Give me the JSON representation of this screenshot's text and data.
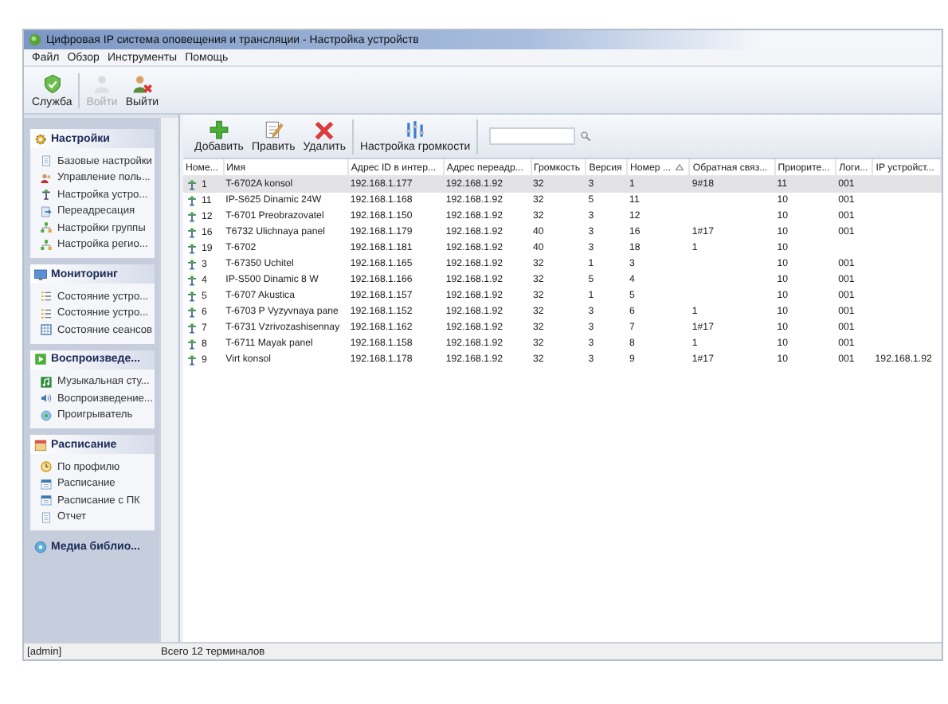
{
  "window": {
    "title": "Цифровая IP система оповещения и трансляции  -  Настройка устройств"
  },
  "menu": [
    "Файл",
    "Обзор",
    "Инструменты",
    "Помощь"
  ],
  "toolbar": [
    {
      "label": "Служба",
      "kind": "service",
      "disabled": false
    },
    {
      "label": "Войти",
      "kind": "login",
      "disabled": true
    },
    {
      "label": "Выйти",
      "kind": "logout",
      "disabled": false
    }
  ],
  "sidebar": {
    "groups": [
      {
        "title": "Настройки",
        "kind": "settings",
        "expanded": true,
        "items": [
          {
            "label": "Базовые настройки",
            "kind": "doc"
          },
          {
            "label": "Управление поль...",
            "kind": "users"
          },
          {
            "label": "Настройка устро...",
            "kind": "device"
          },
          {
            "label": "Переадресация",
            "kind": "redirect"
          },
          {
            "label": "Настройки группы",
            "kind": "group"
          },
          {
            "label": "Настройка регио...",
            "kind": "group"
          }
        ]
      },
      {
        "title": "Мониторинг",
        "kind": "monitor",
        "expanded": true,
        "items": [
          {
            "label": "Состояние устро...",
            "kind": "list"
          },
          {
            "label": "Состояние устро...",
            "kind": "list"
          },
          {
            "label": "Состояние сеансов",
            "kind": "grid"
          }
        ]
      },
      {
        "title": "Воспроизведе...",
        "kind": "play",
        "expanded": true,
        "items": [
          {
            "label": "Музыкальная сту...",
            "kind": "music"
          },
          {
            "label": "Воспроизведение...",
            "kind": "speaker"
          },
          {
            "label": "Проигрыватель",
            "kind": "disc"
          }
        ]
      },
      {
        "title": "Расписание",
        "kind": "schedule",
        "expanded": true,
        "items": [
          {
            "label": "По профилю",
            "kind": "clock"
          },
          {
            "label": "Расписание",
            "kind": "calendar"
          },
          {
            "label": "Расписание с ПК",
            "kind": "calendar"
          },
          {
            "label": "Отчет",
            "kind": "doc"
          }
        ]
      },
      {
        "title": "Медиа библио...",
        "kind": "media",
        "expanded": false
      }
    ]
  },
  "content_toolbar": {
    "buttons": [
      {
        "label": "Добавить",
        "kind": "add"
      },
      {
        "label": "Править",
        "kind": "edit"
      },
      {
        "label": "Удалить",
        "kind": "delete"
      },
      {
        "label": "Настройка громкости",
        "kind": "volume"
      }
    ]
  },
  "table": {
    "columns": [
      {
        "label": "Номе...",
        "sorted": false
      },
      {
        "label": "Имя",
        "sorted": false
      },
      {
        "label": "Адрес ID в интер...",
        "sorted": false
      },
      {
        "label": "Адрес переадр...",
        "sorted": false
      },
      {
        "label": "Громкость",
        "sorted": false
      },
      {
        "label": "Версия",
        "sorted": false
      },
      {
        "label": "Номер ...",
        "sorted": true
      },
      {
        "label": "Обратная связ...",
        "sorted": false
      },
      {
        "label": "Приорите...",
        "sorted": false
      },
      {
        "label": "Логи...",
        "sorted": false
      },
      {
        "label": "IP устройст...",
        "sorted": false
      }
    ],
    "rows": [
      {
        "selected": true,
        "cells": [
          "1",
          "T-6702A konsol",
          "192.168.1.177",
          "192.168.1.92",
          "32",
          "3",
          "1",
          "9#18",
          "11",
          "001",
          ""
        ]
      },
      {
        "selected": false,
        "cells": [
          "11",
          "IP-S625 Dinamic 24W",
          "192.168.1.168",
          "192.168.1.92",
          "32",
          "5",
          "11",
          "",
          "10",
          "001",
          ""
        ]
      },
      {
        "selected": false,
        "cells": [
          "12",
          "T-6701 Preobrazovatel",
          "192.168.1.150",
          "192.168.1.92",
          "32",
          "3",
          "12",
          "",
          "10",
          "001",
          ""
        ]
      },
      {
        "selected": false,
        "cells": [
          "16",
          "T6732 Ulichnaya panel",
          "192.168.1.179",
          "192.168.1.92",
          "40",
          "3",
          "16",
          "1#17",
          "10",
          "001",
          ""
        ]
      },
      {
        "selected": false,
        "cells": [
          "19",
          "T-6702",
          "192.168.1.181",
          "192.168.1.92",
          "40",
          "3",
          "18",
          "1",
          "10",
          "",
          ""
        ]
      },
      {
        "selected": false,
        "cells": [
          "3",
          "T-67350 Uchitel",
          "192.168.1.165",
          "192.168.1.92",
          "32",
          "1",
          "3",
          "",
          "10",
          "001",
          ""
        ]
      },
      {
        "selected": false,
        "cells": [
          "4",
          "IP-S500 Dinamic 8 W",
          "192.168.1.166",
          "192.168.1.92",
          "32",
          "5",
          "4",
          "",
          "10",
          "001",
          ""
        ]
      },
      {
        "selected": false,
        "cells": [
          "5",
          "T-6707 Akustica",
          "192.168.1.157",
          "192.168.1.92",
          "32",
          "1",
          "5",
          "",
          "10",
          "001",
          ""
        ]
      },
      {
        "selected": false,
        "cells": [
          "6",
          "T-6703 P Vyzyvnaya pane",
          "192.168.1.152",
          "192.168.1.92",
          "32",
          "3",
          "6",
          "1",
          "10",
          "001",
          ""
        ]
      },
      {
        "selected": false,
        "cells": [
          "7",
          "T-6731 Vzrivozashisennay",
          "192.168.1.162",
          "192.168.1.92",
          "32",
          "3",
          "7",
          "1#17",
          "10",
          "001",
          ""
        ]
      },
      {
        "selected": false,
        "cells": [
          "8",
          "T-6711 Mayak panel",
          "192.168.1.158",
          "192.168.1.92",
          "32",
          "3",
          "8",
          "1",
          "10",
          "001",
          ""
        ]
      },
      {
        "selected": false,
        "cells": [
          "9",
          "Virt konsol",
          "192.168.1.178",
          "192.168.1.92",
          "32",
          "3",
          "9",
          "1#17",
          "10",
          "001",
          "192.168.1.92"
        ]
      }
    ]
  },
  "status_bar": {
    "user": "[admin]",
    "message": "Всего 12 терминалов"
  }
}
